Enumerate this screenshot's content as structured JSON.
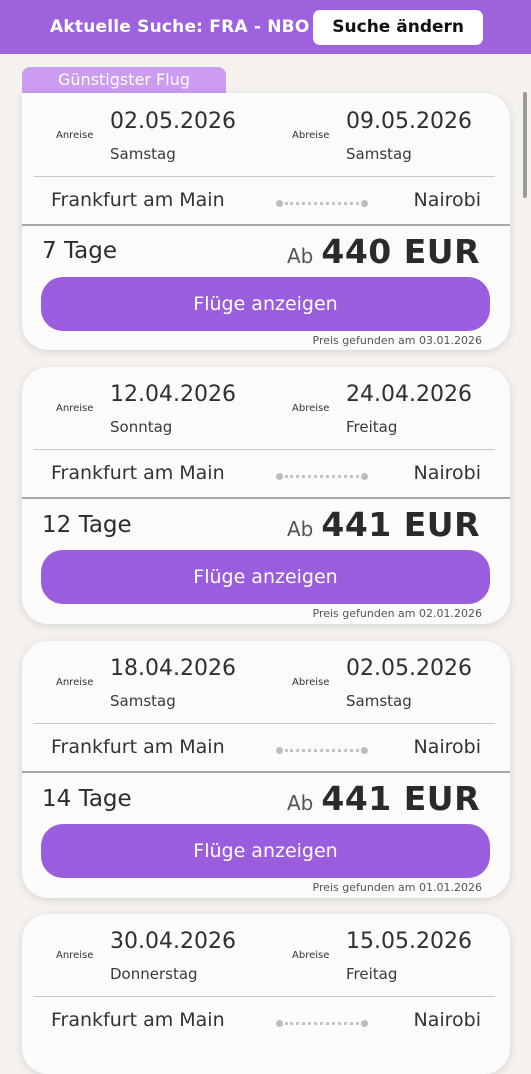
{
  "header": {
    "title": "Aktuelle Suche: FRA - NBO",
    "change_button": "Suche ändern"
  },
  "cheapest_tag": "Günstigster Flug",
  "labels": {
    "departure": "Anreise",
    "return": "Abreise",
    "price_prefix": "Ab",
    "show_flights": "Flüge anzeigen"
  },
  "flights": [
    {
      "depart_date": "02.05.2026",
      "depart_day": "Samstag",
      "return_date": "09.05.2026",
      "return_day": "Samstag",
      "from": "Frankfurt am Main",
      "to": "Nairobi",
      "duration": "7 Tage",
      "price": "440 EUR",
      "found": "Preis gefunden am 03.01.2026"
    },
    {
      "depart_date": "12.04.2026",
      "depart_day": "Sonntag",
      "return_date": "24.04.2026",
      "return_day": "Freitag",
      "from": "Frankfurt am Main",
      "to": "Nairobi",
      "duration": "12 Tage",
      "price": "441 EUR",
      "found": "Preis gefunden am 02.01.2026"
    },
    {
      "depart_date": "18.04.2026",
      "depart_day": "Samstag",
      "return_date": "02.05.2026",
      "return_day": "Samstag",
      "from": "Frankfurt am Main",
      "to": "Nairobi",
      "duration": "14 Tage",
      "price": "441 EUR",
      "found": "Preis gefunden am 01.01.2026"
    },
    {
      "depart_date": "30.04.2026",
      "depart_day": "Donnerstag",
      "return_date": "15.05.2026",
      "return_day": "Freitag",
      "from": "Frankfurt am Main",
      "to": "Nairobi",
      "duration": "",
      "price": "",
      "found": ""
    }
  ],
  "colors": {
    "accent": "#9a5ddd",
    "header": "#9f62dd",
    "tag": "#cb9cf0",
    "background": "#f4f1ee"
  }
}
